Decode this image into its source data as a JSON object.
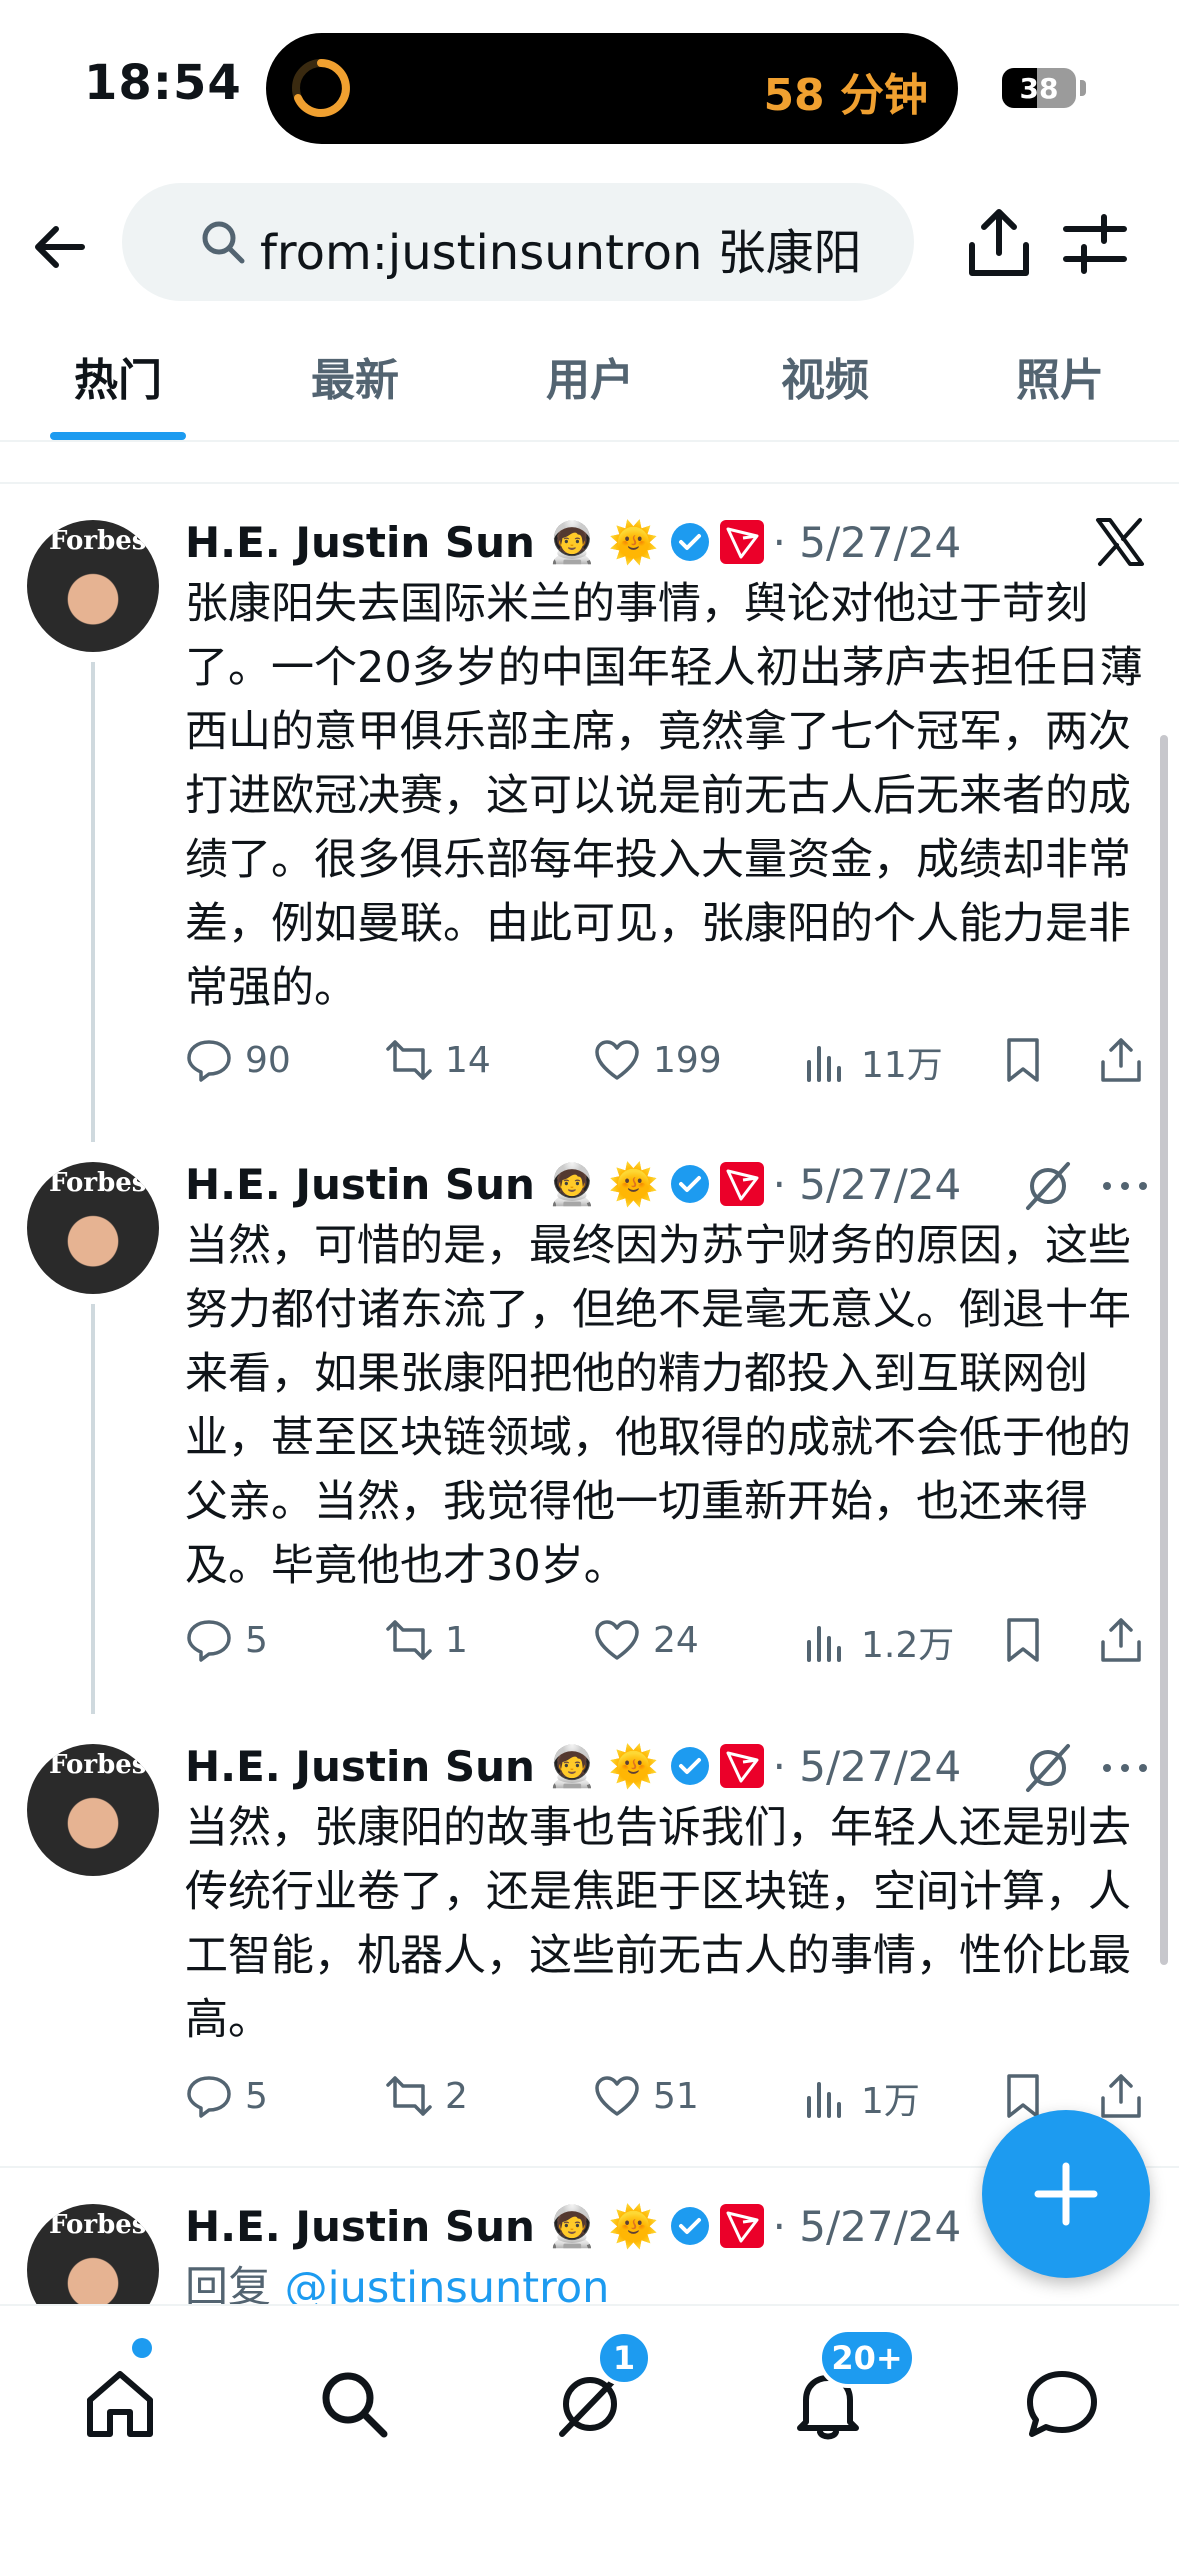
{
  "status_bar": {
    "time": "18:54",
    "island_text": "58 分钟",
    "battery": "38"
  },
  "search": {
    "query": "from:justinsuntron 张康阳"
  },
  "tabs": [
    {
      "label": "热门",
      "active": true
    },
    {
      "label": "最新",
      "active": false
    },
    {
      "label": "用户",
      "active": false
    },
    {
      "label": "视频",
      "active": false
    },
    {
      "label": "照片",
      "active": false
    }
  ],
  "tweets": [
    {
      "author": "H.E. Justin Sun",
      "emoji1": "🧑‍🚀",
      "emoji2": "🌞",
      "date": "· 5/27/24",
      "text": "张康阳失去国际米兰的事情，舆论对他过于苛刻了。一个20多岁的中国年轻人初出茅庐去担任日薄西山的意甲俱乐部主席，竟然拿了七个冠军，两次打进欧冠决赛，这可以说是前无古人后无来者的成绩了。很多俱乐部每年投入大量资金，成绩却非常差，例如曼联。由此可见，张康阳的个人能力是非常强的。",
      "replies": "90",
      "retweets": "14",
      "likes": "199",
      "views": "11万"
    },
    {
      "author": "H.E. Justin Sun",
      "emoji1": "🧑‍🚀",
      "emoji2": "🌞",
      "date": "· 5/27/24",
      "text": "当然，可惜的是，最终因为苏宁财务的原因，这些努力都付诸东流了，但绝不是毫无意义。倒退十年来看，如果张康阳把他的精力都投入到互联网创业，甚至区块链领域，他取得的成就不会低于他的父亲。当然，我觉得他一切重新开始，也还来得及。毕竟他也才30岁。",
      "replies": "5",
      "retweets": "1",
      "likes": "24",
      "views": "1.2万"
    },
    {
      "author": "H.E. Justin Sun",
      "emoji1": "🧑‍🚀",
      "emoji2": "🌞",
      "date": "· 5/27/24",
      "text": "当然，张康阳的故事也告诉我们，年轻人还是别去传统行业卷了，还是焦距于区块链，空间计算，人工智能，机器人，这些前无古人的事情，性价比最高。",
      "replies": "5",
      "retweets": "2",
      "likes": "51",
      "views": "1万"
    },
    {
      "author": "H.E. Justin Sun",
      "emoji1": "🧑‍🚀",
      "emoji2": "🌞",
      "date": "· 5/27/24",
      "reply_prefix": "回复",
      "reply_to": "@justinsuntron"
    }
  ],
  "avatar_brand": "Forbes",
  "nav": {
    "messages_badge": "1",
    "notifications_badge": "20+"
  },
  "colors": {
    "accent": "#1d9bf0",
    "text": "#0f1419",
    "secondary": "#536471",
    "tron_red": "#eb0029",
    "timer_orange": "#f0a030"
  }
}
